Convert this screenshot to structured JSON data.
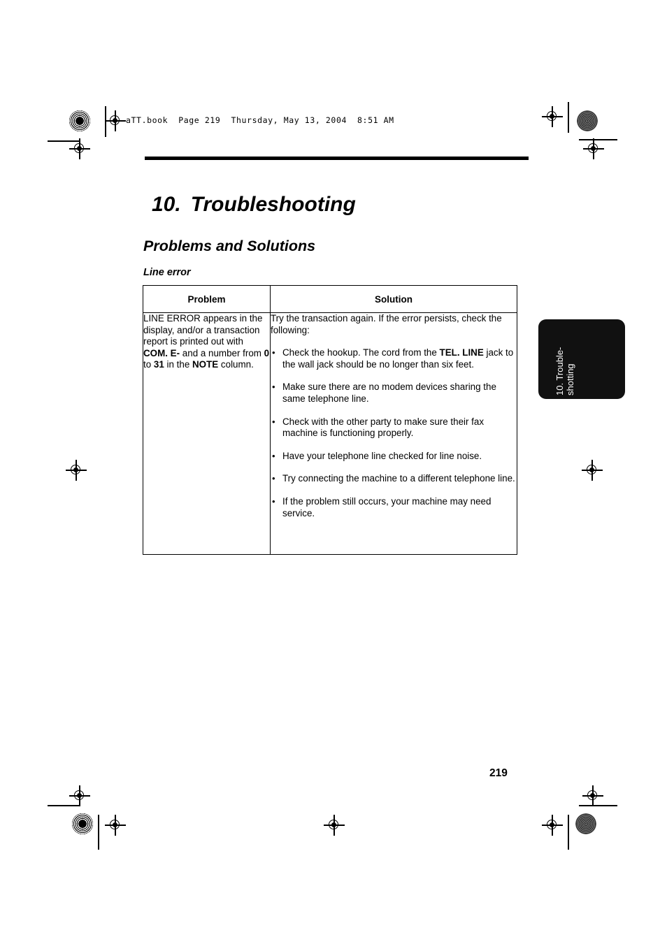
{
  "running_header": "aTT.book  Page 219  Thursday, May 13, 2004  8:51 AM",
  "chapter": {
    "number": "10.",
    "title": "Troubleshooting"
  },
  "section_title": "Problems and Solutions",
  "subsection_title": "Line error",
  "table": {
    "headers": {
      "problem": "Problem",
      "solution": "Solution"
    },
    "row": {
      "problem_segments": [
        {
          "text": "LINE ERROR appears in the display, and/or a transaction report is printed out with ",
          "bold": false
        },
        {
          "text": "COM. E-",
          "bold": true
        },
        {
          "text": " and a number from ",
          "bold": false
        },
        {
          "text": "0",
          "bold": true
        },
        {
          "text": " to ",
          "bold": false
        },
        {
          "text": "31",
          "bold": true
        },
        {
          "text": " in the ",
          "bold": false
        },
        {
          "text": "NOTE",
          "bold": true
        },
        {
          "text": " column.",
          "bold": false
        }
      ],
      "solution_intro": "Try the transaction again. If the error persists, check the following:",
      "bullet_char": "•",
      "solution_bullets": [
        [
          {
            "text": "Check the hookup. The cord from the ",
            "bold": false
          },
          {
            "text": "TEL. LINE",
            "bold": true
          },
          {
            "text": " jack to the wall jack should be no longer than six feet.",
            "bold": false
          }
        ],
        [
          {
            "text": "Make sure there are no modem devices sharing the same telephone line.",
            "bold": false
          }
        ],
        [
          {
            "text": "Check with the other party to make sure their fax machine is functioning properly.",
            "bold": false
          }
        ],
        [
          {
            "text": "Have your telephone line checked for line noise.",
            "bold": false
          }
        ],
        [
          {
            "text": "Try connecting the machine to a different telephone line.",
            "bold": false
          }
        ],
        [
          {
            "text": "If the problem still occurs, your machine may need service.",
            "bold": false
          }
        ]
      ]
    }
  },
  "thumb_tab": {
    "line1": "10. Trouble-",
    "line2": "shotting"
  },
  "page_number": "219",
  "colors": {
    "page_background": "#ffffff",
    "text": "#000000",
    "tab_background": "#111111",
    "tab_text": "#ffffff",
    "rule": "#000000"
  }
}
